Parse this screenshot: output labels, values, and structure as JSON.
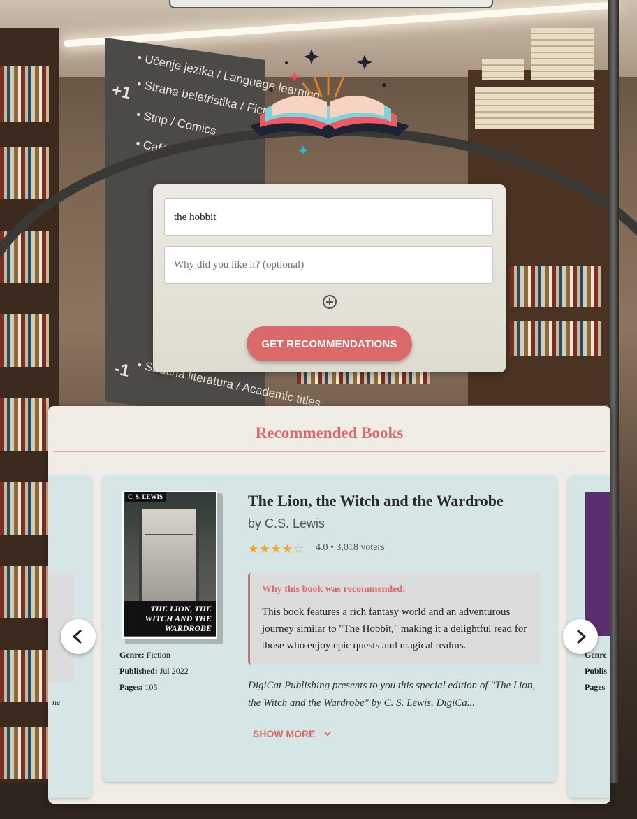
{
  "background": {
    "sign_lines": [
      "+1",
      "• Učenje jezika / Language learning",
      "• Strana beletristika / Fiction",
      "• Strip / Comics",
      "• Café",
      "-1",
      "• Stručna literatura / Academic titles"
    ]
  },
  "search": {
    "book_value": "the hobbit",
    "reason_placeholder": "Why did you like it? (optional)",
    "add_icon": "plus-circle-icon",
    "submit_label": "GET RECOMMENDATIONS"
  },
  "recommendations": {
    "heading": "Recommended Books",
    "current": {
      "title": "The Lion, the Witch and the Wardrobe",
      "author": "by C.S. Lewis",
      "rating_value": 4.0,
      "stars_filled": 4,
      "stars_total": 5,
      "rating_text": "4.0 • 3,018 voters",
      "cover_author": "C. S. LEWIS",
      "cover_title": "THE LION, THE WITCH AND THE WARDROBE",
      "genre_label": "Genre:",
      "genre_value": "Fiction",
      "published_label": "Published:",
      "published_value": "Jul 2022",
      "pages_label": "Pages:",
      "pages_value": "105",
      "why_heading": "Why this book was recommended:",
      "why_text": "This book features a rich fantasy world and an adventurous journey similar to \"The Hobbit,\" making it a delightful read for those who enjoy epic quests and magical realms.",
      "description": "DigiCat Publishing presents to you this special edition of \"The Lion, the Witch and the Wardrobe\" by C. S. Lewis. DigiCa...",
      "show_more": "SHOW MORE"
    },
    "left_peek": {
      "text": "ne"
    },
    "right_peek": {
      "genre": "Genre",
      "published": "Publis",
      "pages": "Pages"
    },
    "prev_icon": "chevron-left-icon",
    "next_icon": "chevron-right-icon"
  },
  "colors": {
    "accent": "#d96a69",
    "card": "#d6e5e6",
    "panel": "#efede6",
    "star": "#f0a81c"
  }
}
